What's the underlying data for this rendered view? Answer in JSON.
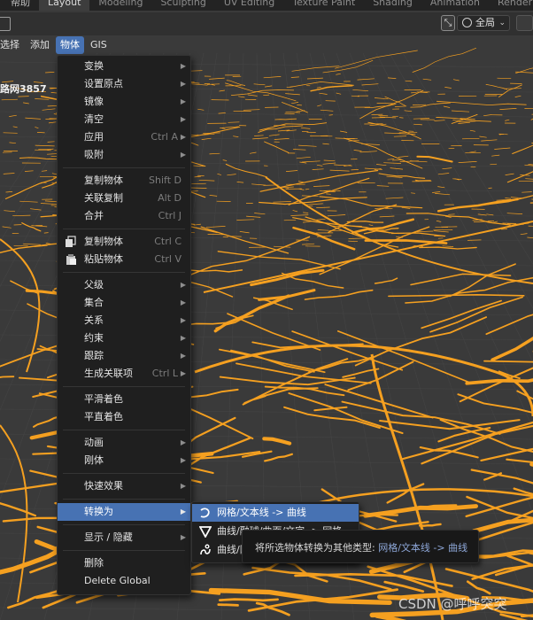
{
  "workspace_tabs": [
    "帮助",
    "Layout",
    "Modeling",
    "Sculpting",
    "UV Editing",
    "Texture Paint",
    "Shading",
    "Animation",
    "Rendering"
  ],
  "active_tab": "Layout",
  "header": {
    "orientation_value": "全局",
    "orientation_icon": "transform-orientation-icon"
  },
  "menubar": [
    "选择",
    "添加",
    "物体",
    "GIS"
  ],
  "active_menu": "物体",
  "object_label": "路网3857",
  "object_menu": {
    "items": [
      {
        "label": "变换",
        "shortcut": "",
        "submenu": true
      },
      {
        "label": "设置原点",
        "shortcut": "",
        "submenu": true
      },
      {
        "label": "镜像",
        "shortcut": "",
        "submenu": true
      },
      {
        "label": "清空",
        "shortcut": "",
        "submenu": true
      },
      {
        "label": "应用",
        "shortcut": "Ctrl A",
        "submenu": true
      },
      {
        "label": "吸附",
        "shortcut": "",
        "submenu": true
      },
      {
        "label": "复制物体",
        "shortcut": "Shift D",
        "submenu": false
      },
      {
        "label": "关联复制",
        "shortcut": "Alt D",
        "submenu": false
      },
      {
        "label": "合并",
        "shortcut": "Ctrl J",
        "submenu": false
      },
      {
        "label": "复制物体",
        "shortcut": "Ctrl C",
        "submenu": false,
        "icon": "copy-icon"
      },
      {
        "label": "粘贴物体",
        "shortcut": "Ctrl V",
        "submenu": false,
        "icon": "paste-icon"
      },
      {
        "label": "父级",
        "shortcut": "",
        "submenu": true
      },
      {
        "label": "集合",
        "shortcut": "",
        "submenu": true
      },
      {
        "label": "关系",
        "shortcut": "",
        "submenu": true
      },
      {
        "label": "约束",
        "shortcut": "",
        "submenu": true
      },
      {
        "label": "跟踪",
        "shortcut": "",
        "submenu": true
      },
      {
        "label": "生成关联项",
        "shortcut": "Ctrl L",
        "submenu": true
      },
      {
        "label": "平滑着色",
        "shortcut": "",
        "submenu": false
      },
      {
        "label": "平直着色",
        "shortcut": "",
        "submenu": false
      },
      {
        "label": "动画",
        "shortcut": "",
        "submenu": true
      },
      {
        "label": "刚体",
        "shortcut": "",
        "submenu": true
      },
      {
        "label": "快速效果",
        "shortcut": "",
        "submenu": true
      },
      {
        "label": "转换为",
        "shortcut": "",
        "submenu": true,
        "highlighted": true
      },
      {
        "label": "显示 / 隐藏",
        "shortcut": "",
        "submenu": true
      },
      {
        "label": "删除",
        "shortcut": "",
        "submenu": false
      },
      {
        "label": "Delete Global",
        "shortcut": "",
        "submenu": false
      }
    ]
  },
  "convert_submenu": {
    "items": [
      {
        "label": "网格/文本线 -> 曲线",
        "icon": "curve-icon",
        "highlighted": true
      },
      {
        "label": "曲线/融球/曲面/文字 -> 网格",
        "icon": "mesh-icon"
      },
      {
        "label": "曲线/网格/曲面/融球/文字 -> 蜡笔",
        "icon": "grease-pencil-icon"
      }
    ]
  },
  "tooltip": {
    "text": "将所选物体转换为其他类型: ",
    "value": "网格/文本线 -> 曲线"
  },
  "watermark": "CSDN @呼呼突突",
  "colors": {
    "accent": "#4772b3",
    "roads": "#f5a020",
    "menu_bg": "#1f1f1f"
  }
}
